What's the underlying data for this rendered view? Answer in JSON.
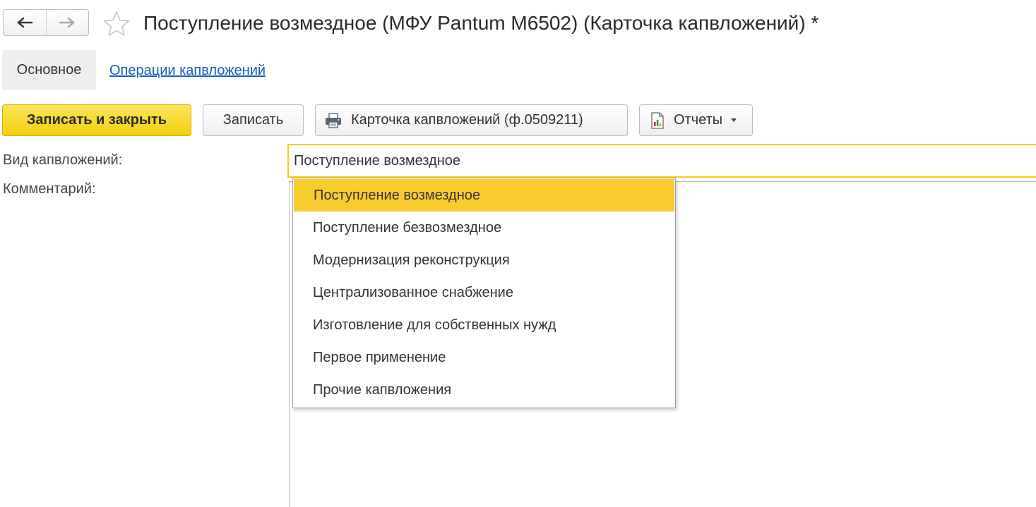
{
  "header": {
    "title": "Поступление возмездное (МФУ Pantum M6502) (Карточка капвложений) *"
  },
  "tabs": {
    "main": "Основное",
    "operations": "Операции капвложений"
  },
  "toolbar": {
    "save_close_label": "Записать и закрыть",
    "save_label": "Записать",
    "card_label": "Карточка капвложений (ф.0509211)",
    "reports_label": "Отчеты"
  },
  "form": {
    "kind_label": "Вид капвложений:",
    "kind_value": "Поступление возмездное",
    "comment_label": "Комментарий:",
    "comment_value": ""
  },
  "dropdown": {
    "selected_index": 0,
    "items": [
      "Поступление возмездное",
      "Поступление безвозмездное",
      "Модернизация реконструкция",
      "Централизованное снабжение",
      "Изготовление для собственных нужд",
      "Первое применение",
      "Прочие капвложения"
    ]
  },
  "colors": {
    "accent_yellow": "#f8cc2e",
    "primary_button": "#f3cf0d",
    "link": "#1a5bbf",
    "field_focus_border": "#f2cb1d"
  },
  "icons": {
    "back": "arrow-left-icon",
    "forward": "arrow-right-icon",
    "favorite": "star-icon",
    "print": "printer-icon",
    "reports": "report-chart-icon",
    "reports_caret": "chevron-down-icon"
  }
}
